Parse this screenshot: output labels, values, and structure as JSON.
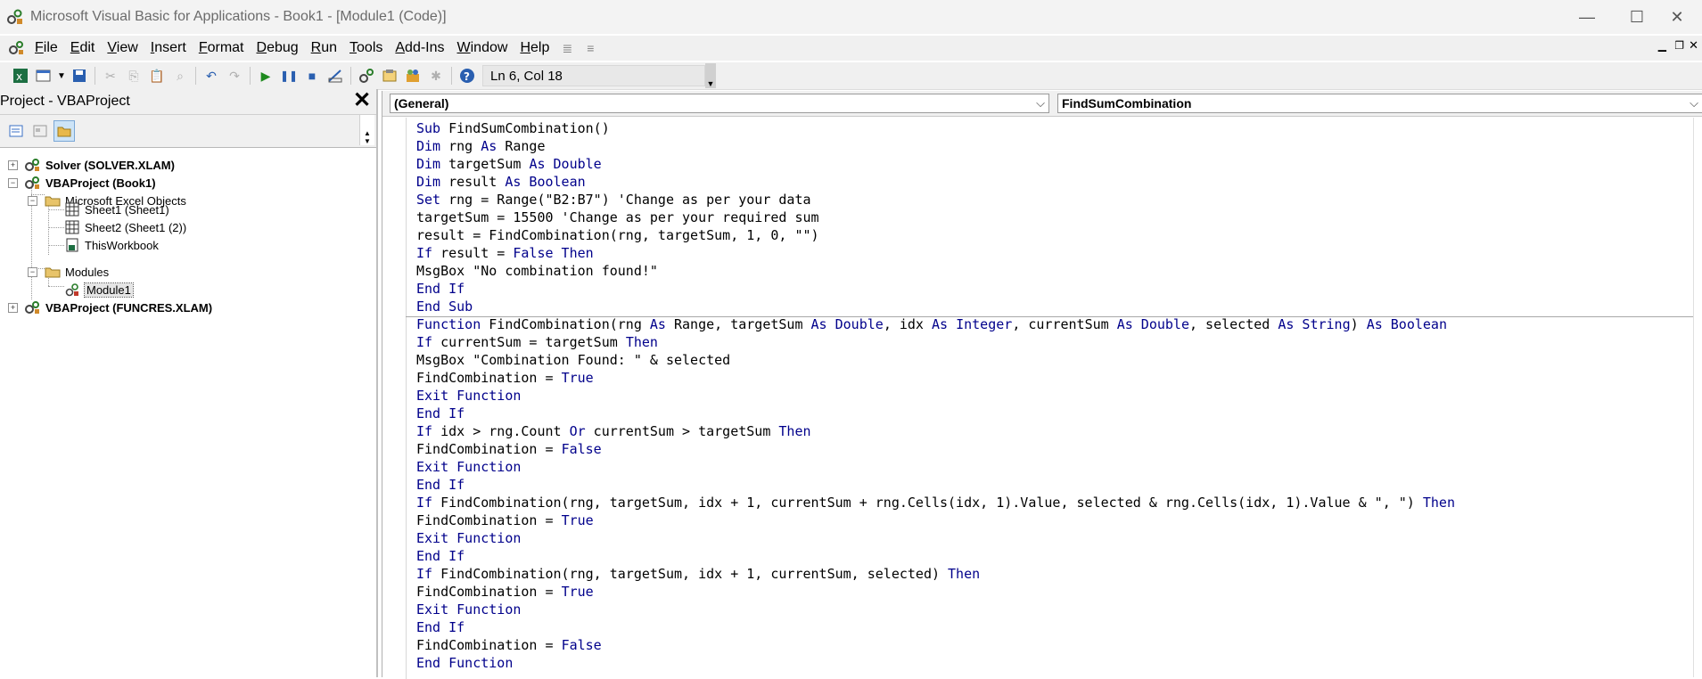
{
  "window": {
    "title": "Microsoft Visual Basic for Applications - Book1 - [Module1 (Code)]",
    "minimize_glyph": "—",
    "maximize_glyph": "☐",
    "close_glyph": "✕"
  },
  "menu": {
    "items": [
      {
        "label": "File",
        "key": "F",
        "rest": "ile"
      },
      {
        "label": "Edit",
        "key": "E",
        "rest": "dit"
      },
      {
        "label": "View",
        "key": "V",
        "rest": "iew"
      },
      {
        "label": "Insert",
        "key": "I",
        "rest": "nsert"
      },
      {
        "label": "Format",
        "key": "F",
        "rest": "ormat"
      },
      {
        "label": "Debug",
        "key": "D",
        "rest": "ebug"
      },
      {
        "label": "Run",
        "key": "R",
        "rest": "un"
      },
      {
        "label": "Tools",
        "key": "T",
        "rest": "ools"
      },
      {
        "label": "Add-Ins",
        "key": "A",
        "rest": "dd-Ins"
      },
      {
        "label": "Window",
        "key": "W",
        "rest": "indow"
      },
      {
        "label": "Help",
        "key": "H",
        "rest": "elp"
      }
    ]
  },
  "toolbar": {
    "position": "Ln 6, Col 18"
  },
  "project": {
    "title": "Project - VBAProject",
    "close_glyph": "✕",
    "tree": [
      {
        "label": "Solver (SOLVER.XLAM)",
        "bold": true
      },
      {
        "label": "VBAProject (Book1)",
        "bold": true
      },
      {
        "label": "Microsoft Excel Objects",
        "bold": false
      },
      {
        "label": "Sheet1 (Sheet1)",
        "bold": false
      },
      {
        "label": "Sheet2 (Sheet1 (2))",
        "bold": false
      },
      {
        "label": "ThisWorkbook",
        "bold": false
      },
      {
        "label": "Modules",
        "bold": false
      },
      {
        "label": "Module1",
        "bold": false
      },
      {
        "label": "VBAProject (FUNCRES.XLAM)",
        "bold": true
      }
    ]
  },
  "code": {
    "object_combo": "(General)",
    "procedure_combo": "FindSumCombination",
    "lines": [
      [
        [
          "kw",
          "Sub"
        ],
        [
          "t",
          " FindSumCombination()"
        ]
      ],
      [
        [
          "kw",
          "Dim"
        ],
        [
          "t",
          " rng "
        ],
        [
          "kw",
          "As"
        ],
        [
          "t",
          " Range"
        ]
      ],
      [
        [
          "kw",
          "Dim"
        ],
        [
          "t",
          " targetSum "
        ],
        [
          "kw",
          "As Double"
        ]
      ],
      [
        [
          "kw",
          "Dim"
        ],
        [
          "t",
          " result "
        ],
        [
          "kw",
          "As Boolean"
        ]
      ],
      [
        [
          "kw",
          "Set"
        ],
        [
          "t",
          " rng = Range(\"B2:B7\") 'Change as per your data"
        ]
      ],
      [
        [
          "t",
          "targetSum = 15500 'Change as per your required sum"
        ]
      ],
      [
        [
          "t",
          "result = FindCombination(rng, targetSum, 1, 0, \"\")"
        ]
      ],
      [
        [
          "kw",
          "If"
        ],
        [
          "t",
          " result = "
        ],
        [
          "kw",
          "False Then"
        ]
      ],
      [
        [
          "t",
          "MsgBox \"No combination found!\""
        ]
      ],
      [
        [
          "kw",
          "End If"
        ]
      ],
      [
        [
          "kw",
          "End Sub"
        ]
      ],
      [
        [
          "kw",
          "Function"
        ],
        [
          "t",
          " FindCombination(rng "
        ],
        [
          "kw",
          "As"
        ],
        [
          "t",
          " Range, targetSum "
        ],
        [
          "kw",
          "As Double"
        ],
        [
          "t",
          ", idx "
        ],
        [
          "kw",
          "As Integer"
        ],
        [
          "t",
          ", currentSum "
        ],
        [
          "kw",
          "As Double"
        ],
        [
          "t",
          ", selected "
        ],
        [
          "kw",
          "As String"
        ],
        [
          "t",
          ") "
        ],
        [
          "kw",
          "As Boolean"
        ]
      ],
      [
        [
          "kw",
          "If"
        ],
        [
          "t",
          " currentSum = targetSum "
        ],
        [
          "kw",
          "Then"
        ]
      ],
      [
        [
          "t",
          "MsgBox \"Combination Found: \" & selected"
        ]
      ],
      [
        [
          "t",
          "FindCombination = "
        ],
        [
          "kw",
          "True"
        ]
      ],
      [
        [
          "kw",
          "Exit Function"
        ]
      ],
      [
        [
          "kw",
          "End If"
        ]
      ],
      [
        [
          "kw",
          "If"
        ],
        [
          "t",
          " idx > rng.Count "
        ],
        [
          "kw",
          "Or"
        ],
        [
          "t",
          " currentSum > targetSum "
        ],
        [
          "kw",
          "Then"
        ]
      ],
      [
        [
          "t",
          "FindCombination = "
        ],
        [
          "kw",
          "False"
        ]
      ],
      [
        [
          "kw",
          "Exit Function"
        ]
      ],
      [
        [
          "kw",
          "End If"
        ]
      ],
      [
        [
          "kw",
          "If"
        ],
        [
          "t",
          " FindCombination(rng, targetSum, idx + 1, currentSum + rng.Cells(idx, 1).Value, selected & rng.Cells(idx, 1).Value & \", \") "
        ],
        [
          "kw",
          "Then"
        ]
      ],
      [
        [
          "t",
          "FindCombination = "
        ],
        [
          "kw",
          "True"
        ]
      ],
      [
        [
          "kw",
          "Exit Function"
        ]
      ],
      [
        [
          "kw",
          "End If"
        ]
      ],
      [
        [
          "kw",
          "If"
        ],
        [
          "t",
          " FindCombination(rng, targetSum, idx + 1, currentSum, selected) "
        ],
        [
          "kw",
          "Then"
        ]
      ],
      [
        [
          "t",
          "FindCombination = "
        ],
        [
          "kw",
          "True"
        ]
      ],
      [
        [
          "kw",
          "Exit Function"
        ]
      ],
      [
        [
          "kw",
          "End If"
        ]
      ],
      [
        [
          "t",
          "FindCombination = "
        ],
        [
          "kw",
          "False"
        ]
      ],
      [
        [
          "kw",
          "End Function"
        ]
      ]
    ]
  }
}
